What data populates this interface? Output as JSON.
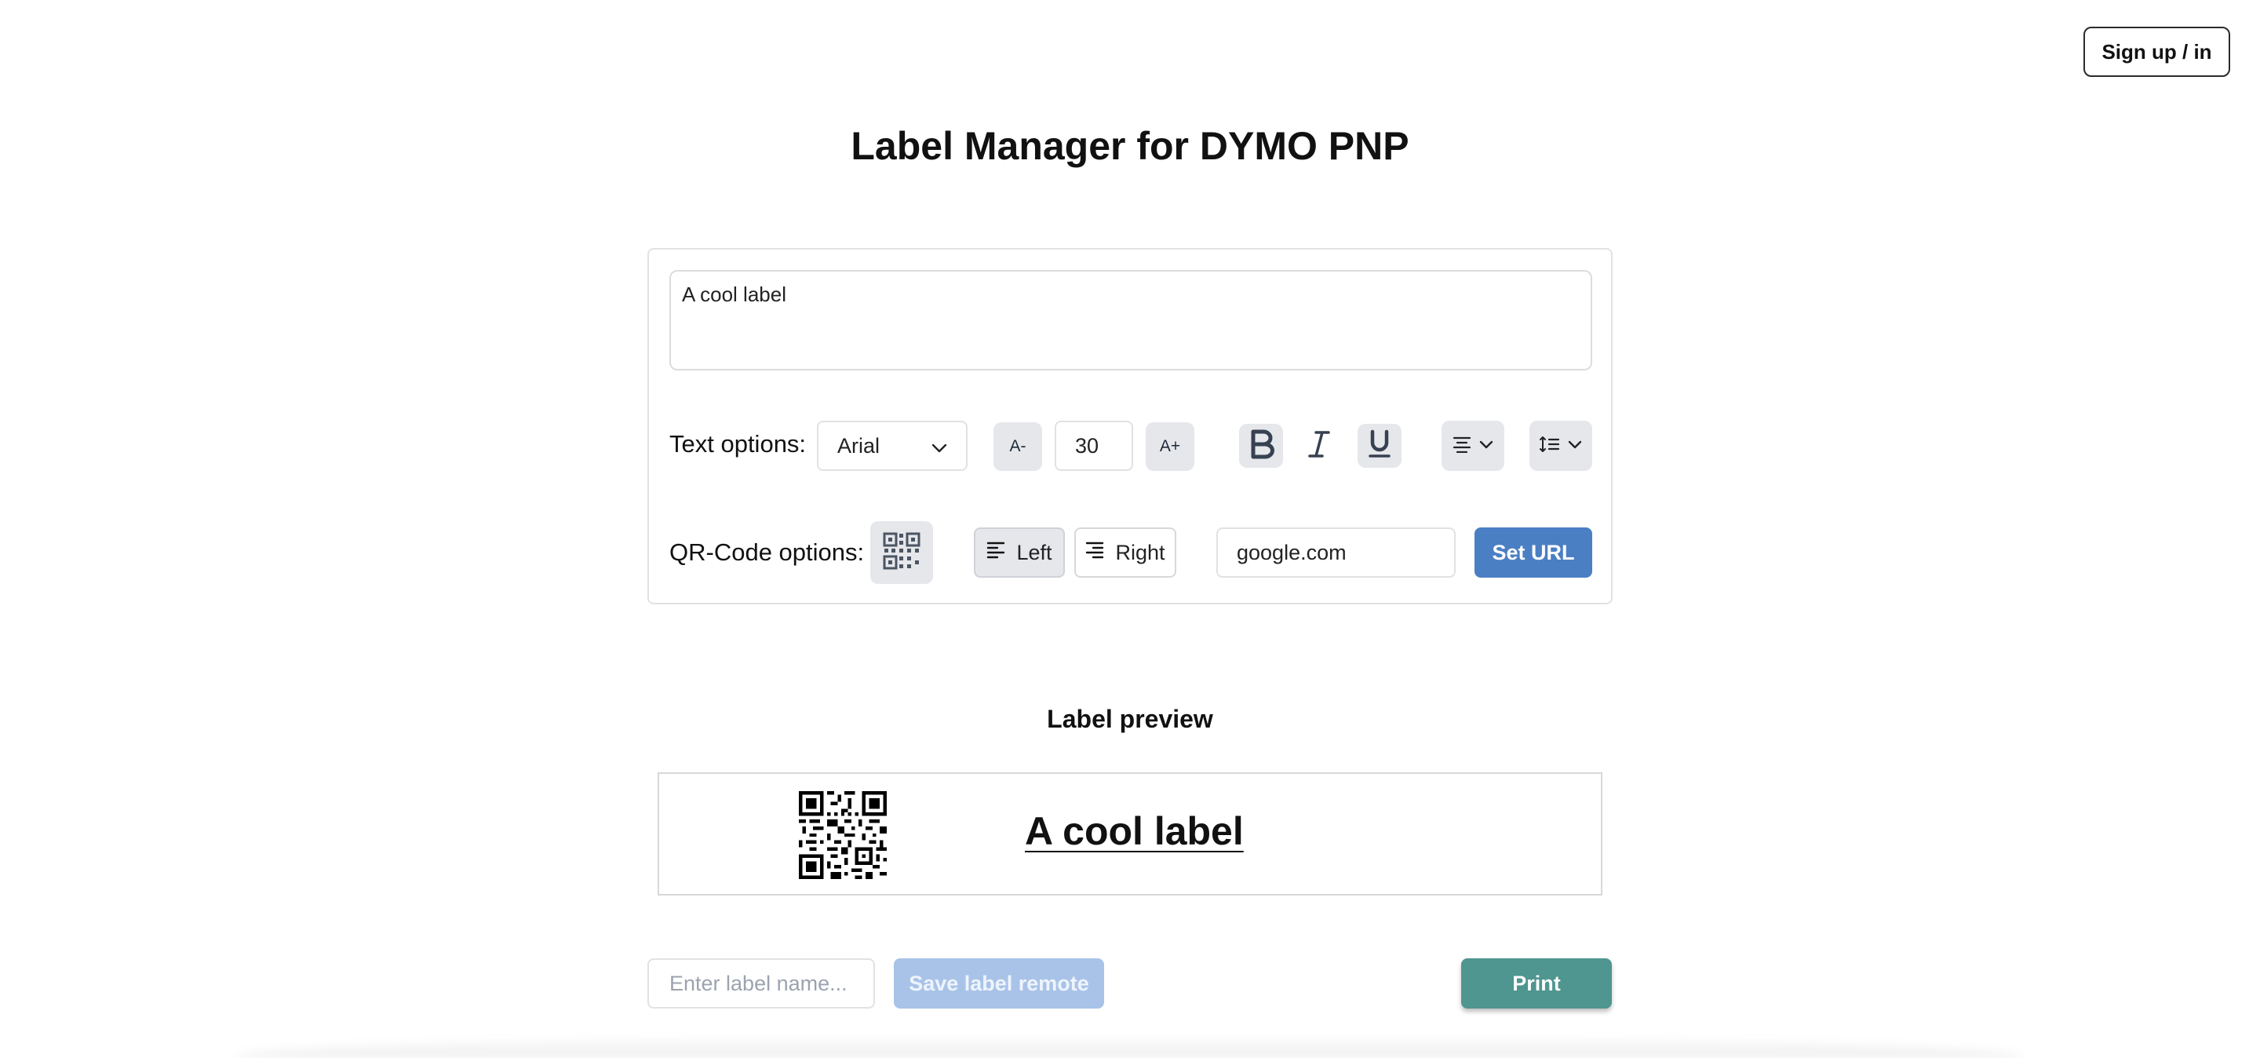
{
  "header": {
    "signin_label": "Sign up / in",
    "title": "Label Manager for DYMO PNP"
  },
  "editor": {
    "label_text": "A cool label",
    "text_options_label": "Text options:",
    "font": "Arial",
    "decrease_size_label": "A-",
    "font_size": "30",
    "increase_size_label": "A+",
    "qr_options_label": "QR-Code options:",
    "qr_left_label": "Left",
    "qr_right_label": "Right",
    "url_value": "google.com",
    "set_url_label": "Set URL"
  },
  "preview": {
    "title": "Label preview",
    "label_text": "A cool label"
  },
  "footer": {
    "name_placeholder": "Enter label name...",
    "save_label": "Save label remote",
    "print_label": "Print"
  },
  "colors": {
    "primary_blue": "#4a7fc4",
    "disabled_blue": "#a9c3e8",
    "print_teal": "#4f9590",
    "active_gray": "#e5e7eb"
  }
}
